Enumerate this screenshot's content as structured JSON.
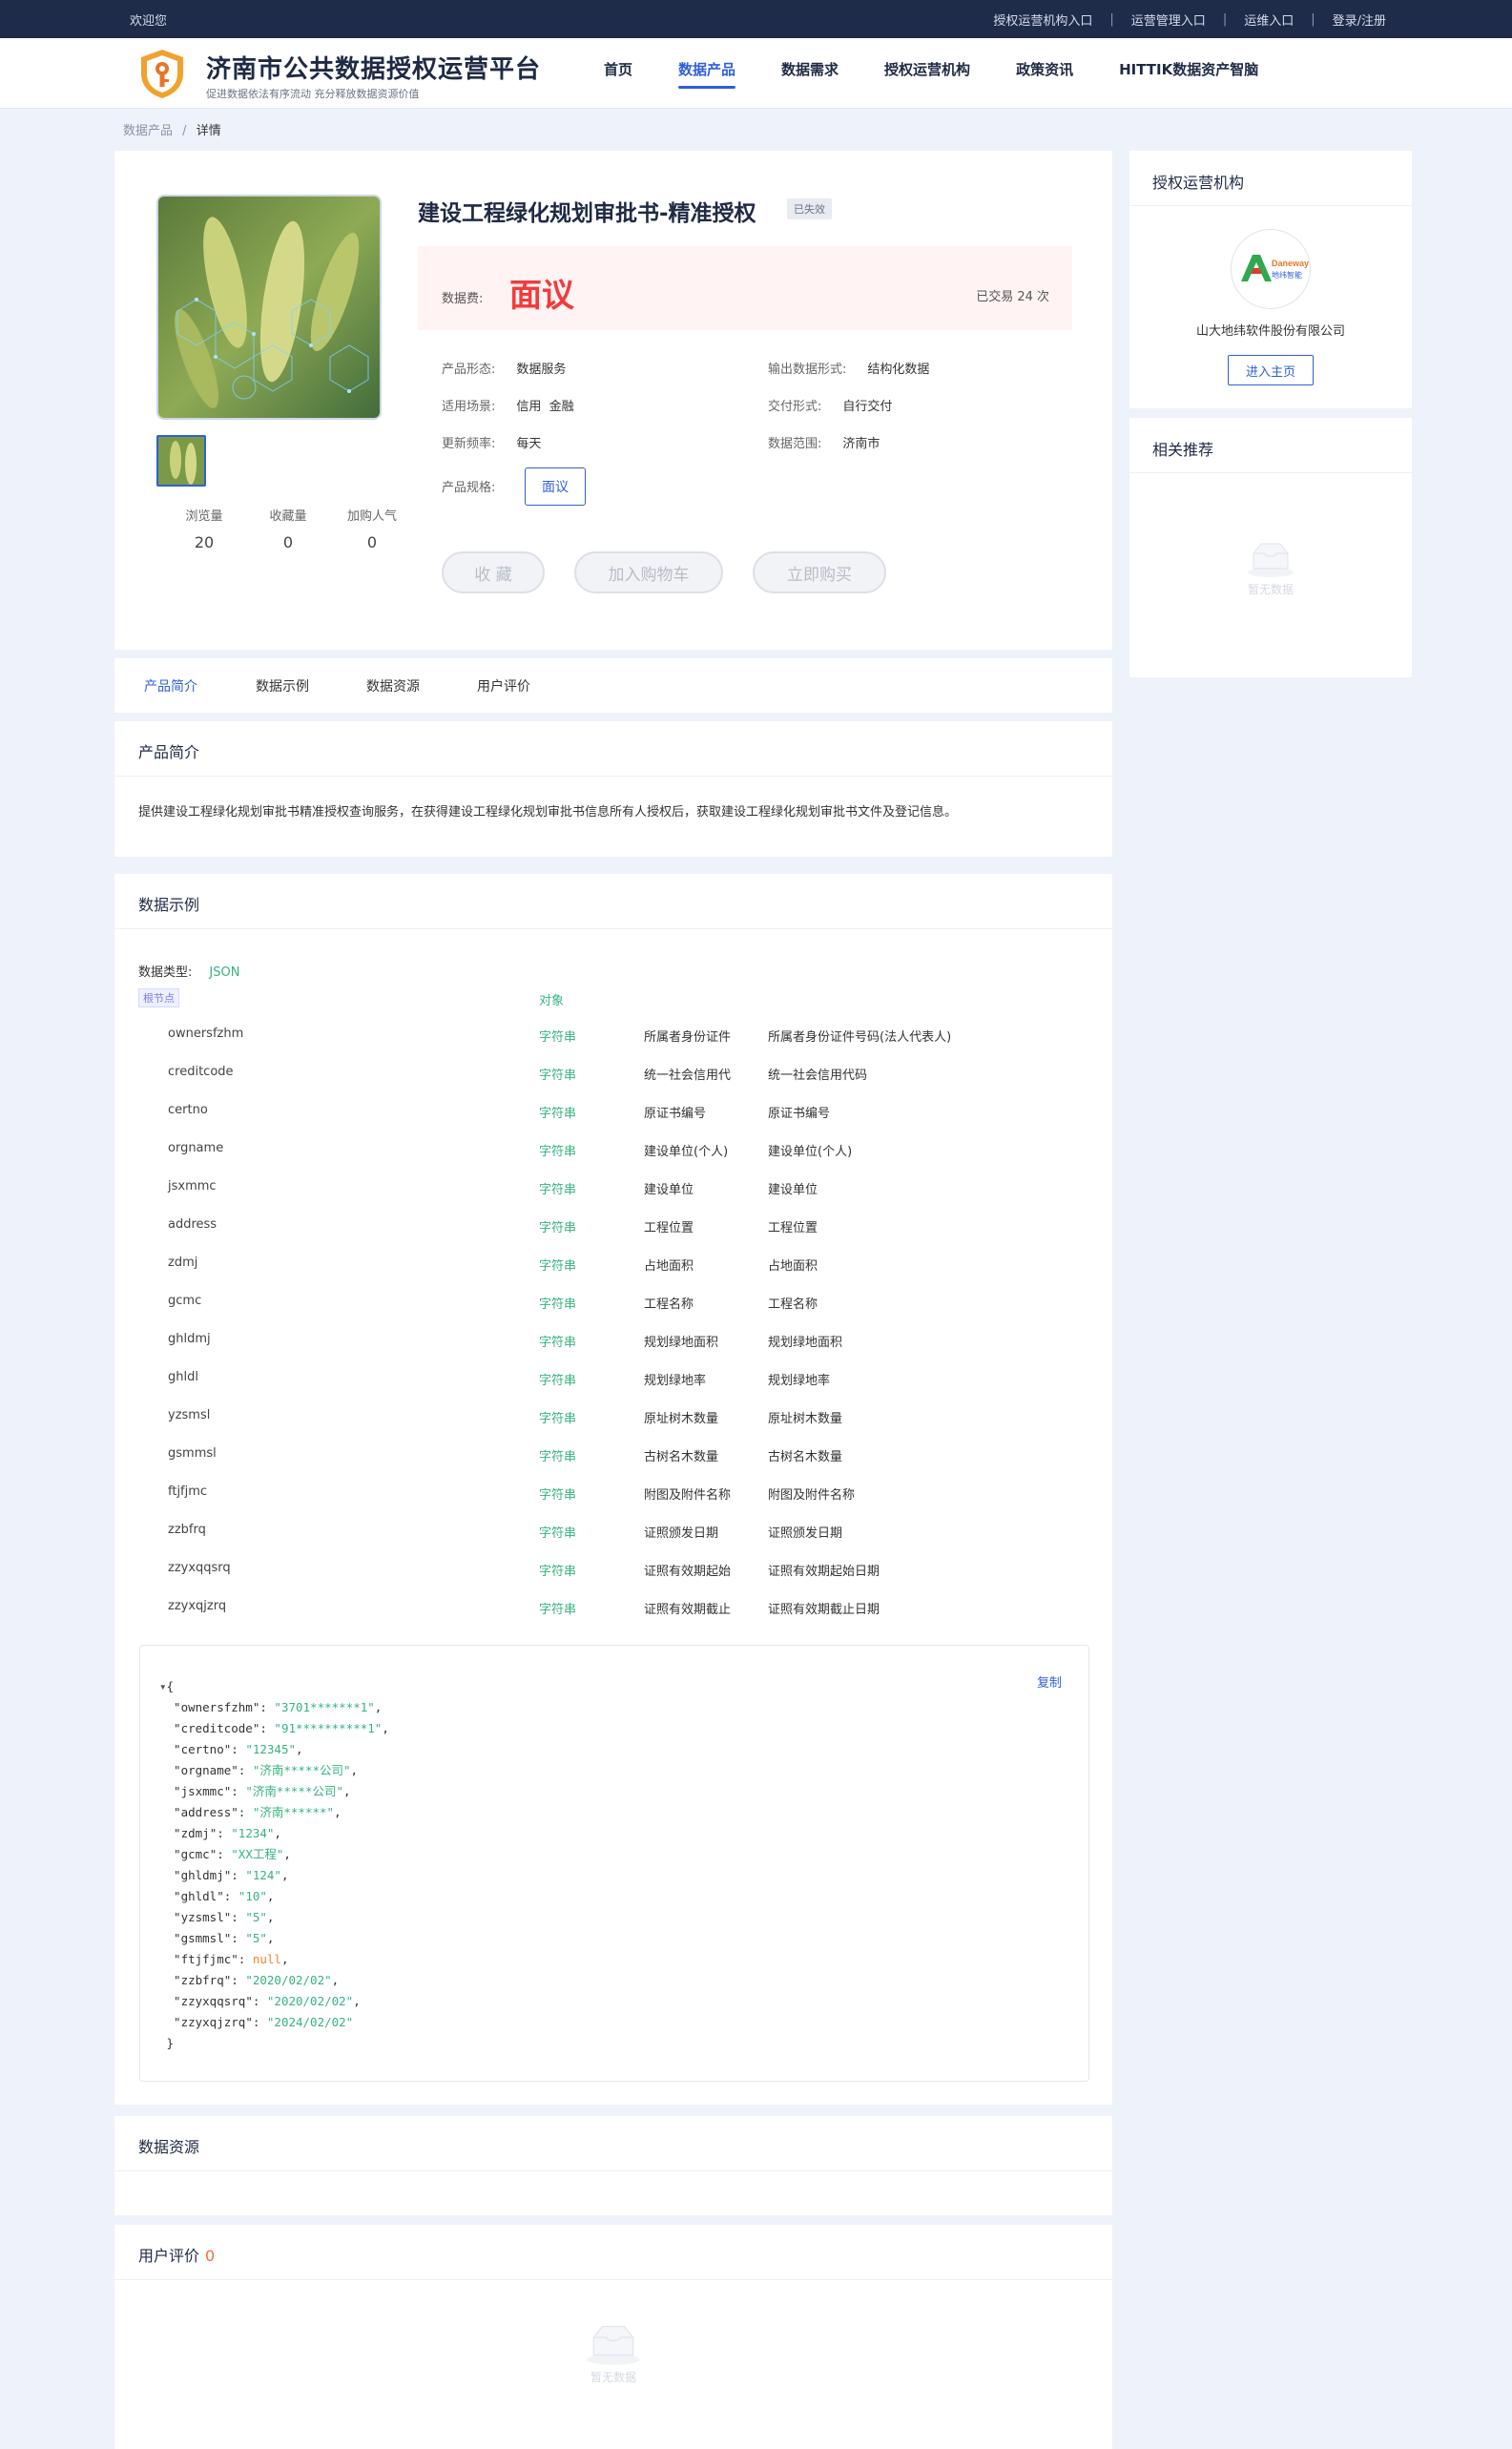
{
  "topbar": {
    "welcome": "欢迎您",
    "links": [
      "授权运营机构入口",
      "运营管理入口",
      "运维入口",
      "登录/注册"
    ]
  },
  "brand": {
    "title": "济南市公共数据授权运营平台",
    "subtitle": "促进数据依法有序流动 充分释放数据资源价值"
  },
  "nav": [
    "首页",
    "数据产品",
    "数据需求",
    "授权运营机构",
    "政策资讯",
    "HITTIK数据资产智脑"
  ],
  "nav_active": "数据产品",
  "breadcrumb": {
    "parent": "数据产品",
    "sep": "/",
    "current": "详情"
  },
  "product": {
    "title": "建设工程绿化规划审批书-精准授权",
    "status": "已失效",
    "price_label": "数据费:",
    "price": "面议",
    "sold": "已交易 24 次",
    "attrs": {
      "form_k": "产品形态:",
      "form_v": "数据服务",
      "output_k": "输出数据形式:",
      "output_v": "结构化数据",
      "scene_k": "适用场景:",
      "scene_v": "信用  金融",
      "delivery_k": "交付形式:",
      "delivery_v": "自行交付",
      "freq_k": "更新频率:",
      "freq_v": "每天",
      "range_k": "数据范围:",
      "range_v": "济南市",
      "spec_k": "产品规格:",
      "spec_v": "面议"
    },
    "stats": [
      {
        "label": "浏览量",
        "value": "20"
      },
      {
        "label": "收藏量",
        "value": "0"
      },
      {
        "label": "加购人气",
        "value": "0"
      }
    ],
    "buttons": {
      "favorite": "收 藏",
      "cart": "加入购物车",
      "buy": "立即购买"
    }
  },
  "side": {
    "org_title": "授权运营机构",
    "org_logo_text1": "Daneway",
    "org_logo_text2": "地纬智能",
    "org_name": "山大地纬软件股份有限公司",
    "home_btn": "进入主页",
    "recommend_title": "相关推荐",
    "empty": "暂无数据"
  },
  "tabs": [
    "产品简介",
    "数据示例",
    "数据资源",
    "用户评价"
  ],
  "intro": {
    "title": "产品简介",
    "text": "提供建设工程绿化规划审批书精准授权查询服务，在获得建设工程绿化规划审批书信息所有人授权后，获取建设工程绿化规划审批书文件及登记信息。"
  },
  "sample": {
    "title": "数据示例",
    "type_label": "数据类型:",
    "type_value": "JSON",
    "root": "根节点",
    "root_type": "对象",
    "fields": [
      {
        "key": "ownersfzhm",
        "type": "字符串",
        "name": "所属者身份证件",
        "desc": "所属者身份证件号码(法人代表人)"
      },
      {
        "key": "creditcode",
        "type": "字符串",
        "name": "统一社会信用代",
        "desc": "统一社会信用代码"
      },
      {
        "key": "certno",
        "type": "字符串",
        "name": "原证书编号",
        "desc": "原证书编号"
      },
      {
        "key": "orgname",
        "type": "字符串",
        "name": "建设单位(个人)",
        "desc": "建设单位(个人)"
      },
      {
        "key": "jsxmmc",
        "type": "字符串",
        "name": "建设单位",
        "desc": "建设单位"
      },
      {
        "key": "address",
        "type": "字符串",
        "name": "工程位置",
        "desc": "工程位置"
      },
      {
        "key": "zdmj",
        "type": "字符串",
        "name": "占地面积",
        "desc": "占地面积"
      },
      {
        "key": "gcmc",
        "type": "字符串",
        "name": "工程名称",
        "desc": "工程名称"
      },
      {
        "key": "ghldmj",
        "type": "字符串",
        "name": "规划绿地面积",
        "desc": "规划绿地面积"
      },
      {
        "key": "ghldl",
        "type": "字符串",
        "name": "规划绿地率",
        "desc": "规划绿地率"
      },
      {
        "key": "yzsmsl",
        "type": "字符串",
        "name": "原址树木数量",
        "desc": "原址树木数量"
      },
      {
        "key": "gsmmsl",
        "type": "字符串",
        "name": "古树名木数量",
        "desc": "古树名木数量"
      },
      {
        "key": "ftjfjmc",
        "type": "字符串",
        "name": "附图及附件名称",
        "desc": "附图及附件名称"
      },
      {
        "key": "zzbfrq",
        "type": "字符串",
        "name": "证照颁发日期",
        "desc": "证照颁发日期"
      },
      {
        "key": "zzyxqqsrq",
        "type": "字符串",
        "name": "证照有效期起始",
        "desc": "证照有效期起始日期"
      },
      {
        "key": "zzyxqjzrq",
        "type": "字符串",
        "name": "证照有效期截止",
        "desc": "证照有效期截止日期"
      }
    ],
    "copy": "复制",
    "json_lines": [
      {
        "k": "ownersfzhm",
        "v": "\"3701*******1\"",
        "t": "s"
      },
      {
        "k": "creditcode",
        "v": "\"91**********1\"",
        "t": "s"
      },
      {
        "k": "certno",
        "v": "\"12345\"",
        "t": "s"
      },
      {
        "k": "orgname",
        "v": "\"济南*****公司\"",
        "t": "s"
      },
      {
        "k": "jsxmmc",
        "v": "\"济南*****公司\"",
        "t": "s"
      },
      {
        "k": "address",
        "v": "\"济南******\"",
        "t": "s"
      },
      {
        "k": "zdmj",
        "v": "\"1234\"",
        "t": "s"
      },
      {
        "k": "gcmc",
        "v": "\"XX工程\"",
        "t": "s"
      },
      {
        "k": "ghldmj",
        "v": "\"124\"",
        "t": "s"
      },
      {
        "k": "ghldl",
        "v": "\"10\"",
        "t": "s"
      },
      {
        "k": "yzsmsl",
        "v": "\"5\"",
        "t": "s"
      },
      {
        "k": "gsmmsl",
        "v": "\"5\"",
        "t": "s"
      },
      {
        "k": "ftjfjmc",
        "v": "null",
        "t": "n"
      },
      {
        "k": "zzbfrq",
        "v": "\"2020/02/02\"",
        "t": "s"
      },
      {
        "k": "zzyxqqsrq",
        "v": "\"2020/02/02\"",
        "t": "s"
      },
      {
        "k": "zzyxqjzrq",
        "v": "\"2024/02/02\"",
        "t": "s"
      }
    ]
  },
  "resources": {
    "title": "数据资源"
  },
  "reviews": {
    "title": "用户评价",
    "count": "0",
    "empty": "暂无数据"
  }
}
